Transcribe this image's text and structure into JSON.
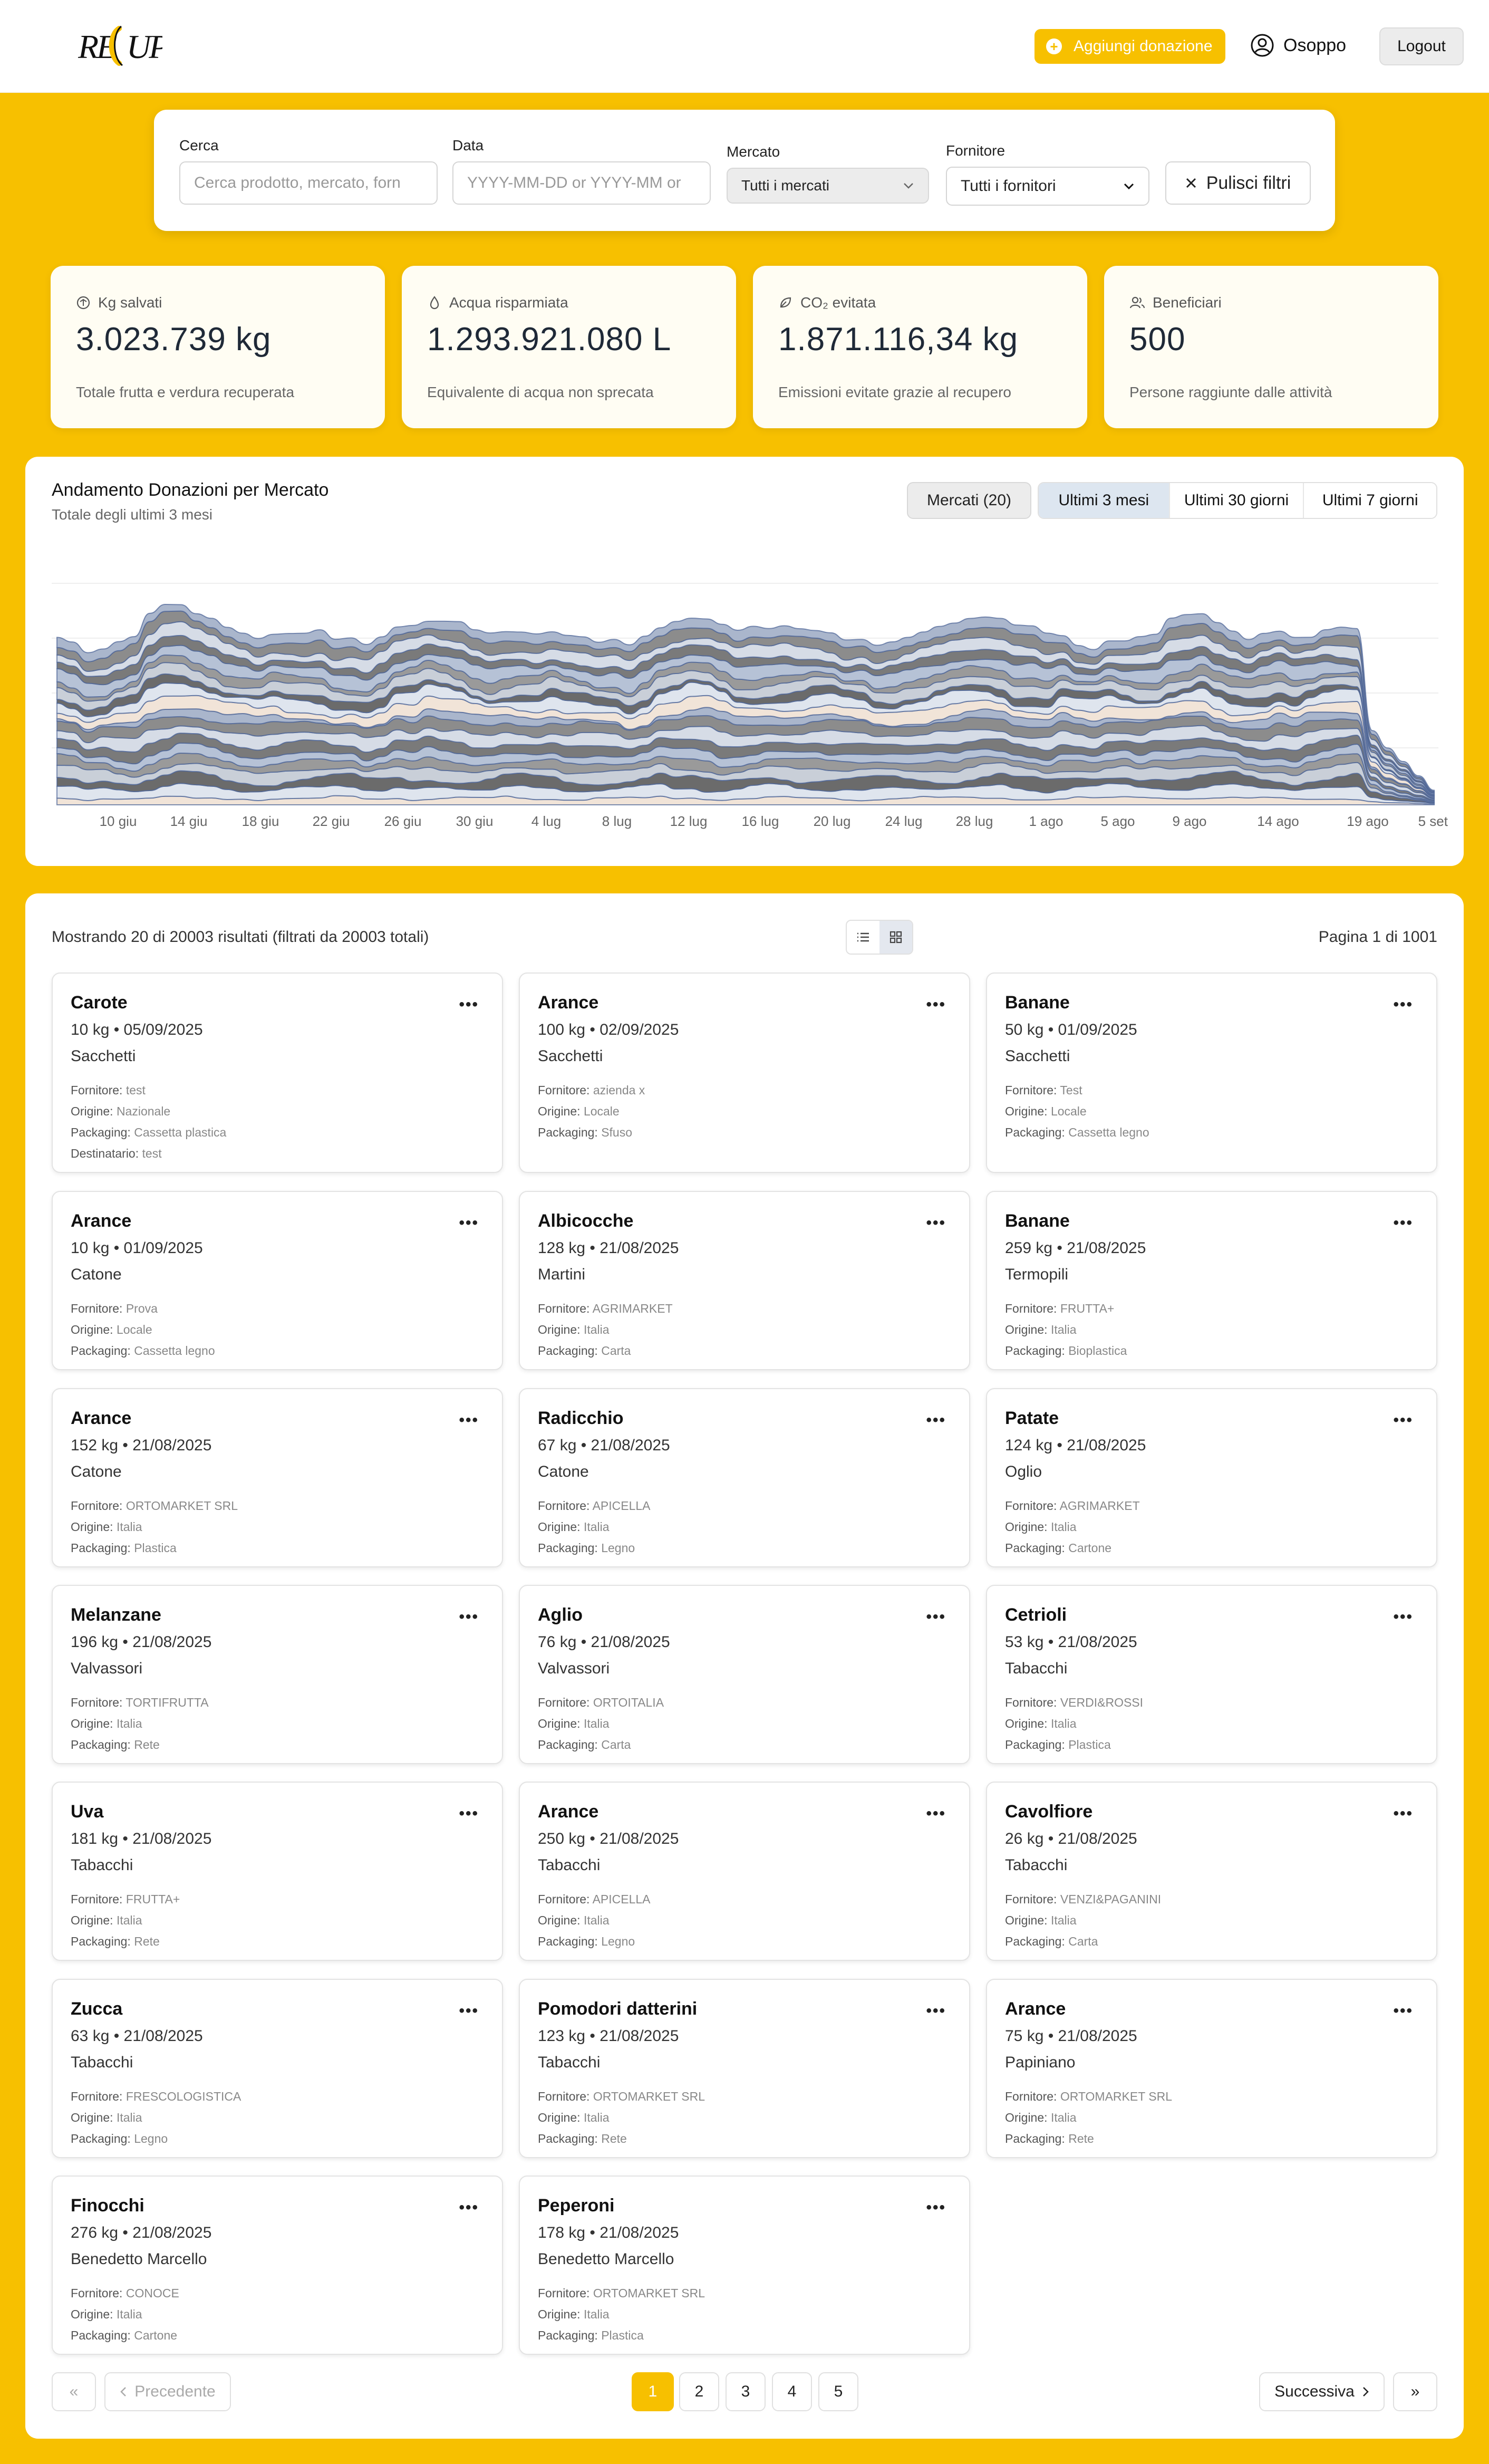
{
  "header": {
    "logo_text": "RECUP",
    "donate_label": "Aggiungi donazione",
    "user_name": "Osoppo",
    "logout_label": "Logout"
  },
  "filters": {
    "search_label": "Cerca",
    "search_placeholder": "Cerca prodotto, mercato, forn",
    "date_label": "Data",
    "date_placeholder": "YYYY-MM-DD or YYYY-MM or",
    "market_label": "Mercato",
    "market_value": "Tutti i mercati",
    "supplier_label": "Fornitore",
    "supplier_value": "Tutti i fornitori",
    "clear_label": "Pulisci filtri"
  },
  "stats": [
    {
      "label": "Kg salvati",
      "value": "3.023.739 kg",
      "desc": "Totale frutta e verdura recuperata",
      "icon": "scale-icon"
    },
    {
      "label": "Acqua risparmiata",
      "value": "1.293.921.080 L",
      "desc": "Equivalente di acqua non sprecata",
      "icon": "droplet-icon"
    },
    {
      "label": "CO₂ evitata",
      "value": "1.871.116,34 kg",
      "desc": "Emissioni evitate grazie al recupero",
      "icon": "leaf-icon"
    },
    {
      "label": "Beneficiari",
      "value": "500",
      "desc": "Persone raggiunte dalle attività",
      "icon": "users-icon"
    }
  ],
  "chart": {
    "title": "Andamento Donazioni per Mercato",
    "subtitle": "Totale degli ultimi 3 mesi",
    "markets_button": "Mercati (20)",
    "ranges": [
      "Ultimi 3 mesi",
      "Ultimi 30 giorni",
      "Ultimi 7 giorni"
    ],
    "active_range": "Ultimi 3 mesi"
  },
  "chart_data": {
    "type": "area",
    "x_tick_labels": [
      "10 giu",
      "14 giu",
      "18 giu",
      "22 giu",
      "26 giu",
      "30 giu",
      "4 lug",
      "8 lug",
      "12 lug",
      "16 lug",
      "20 lug",
      "24 lug",
      "28 lug",
      "1 ago",
      "5 ago",
      "9 ago",
      "14 ago",
      "19 ago",
      "5 set"
    ],
    "stacked": true,
    "series_count": 20,
    "grid": "horizontal",
    "colors": [
      "#f1e4d8",
      "#dfe5ee",
      "#6b6b6b",
      "#c9cfd8",
      "#9a9a9a",
      "#b6c2d6",
      "#7a7a7a",
      "#d6dce6",
      "#8c8c8c",
      "#aab6cc"
    ]
  },
  "results": {
    "summary": "Mostrando 20 di 20003 risultati (filtrati da 20003 totali)",
    "page_info": "Pagina 1 di 1001",
    "labels": {
      "fornitore": "Fornitore:",
      "origine": "Origine:",
      "packaging": "Packaging:",
      "destinatario": "Destinatario:"
    },
    "items": [
      {
        "name": "Carote",
        "kgdate": "10 kg • 05/09/2025",
        "market": "Sacchetti",
        "fornitore": "test",
        "origine": "Nazionale",
        "packaging": "Cassetta plastica",
        "destinatario": "test"
      },
      {
        "name": "Arance",
        "kgdate": "100 kg • 02/09/2025",
        "market": "Sacchetti",
        "fornitore": "azienda x",
        "origine": "Locale",
        "packaging": "Sfuso"
      },
      {
        "name": "Banane",
        "kgdate": "50 kg • 01/09/2025",
        "market": "Sacchetti",
        "fornitore": "Test",
        "origine": "Locale",
        "packaging": "Cassetta legno"
      },
      {
        "name": "Arance",
        "kgdate": "10 kg • 01/09/2025",
        "market": "Catone",
        "fornitore": "Prova",
        "origine": "Locale",
        "packaging": "Cassetta legno"
      },
      {
        "name": "Albicocche",
        "kgdate": "128 kg • 21/08/2025",
        "market": "Martini",
        "fornitore": "AGRIMARKET",
        "origine": "Italia",
        "packaging": "Carta"
      },
      {
        "name": "Banane",
        "kgdate": "259 kg • 21/08/2025",
        "market": "Termopili",
        "fornitore": "FRUTTA+",
        "origine": "Italia",
        "packaging": "Bioplastica"
      },
      {
        "name": "Arance",
        "kgdate": "152 kg • 21/08/2025",
        "market": "Catone",
        "fornitore": "ORTOMARKET SRL",
        "origine": "Italia",
        "packaging": "Plastica"
      },
      {
        "name": "Radicchio",
        "kgdate": "67 kg • 21/08/2025",
        "market": "Catone",
        "fornitore": "APICELLA",
        "origine": "Italia",
        "packaging": "Legno"
      },
      {
        "name": "Patate",
        "kgdate": "124 kg • 21/08/2025",
        "market": "Oglio",
        "fornitore": "AGRIMARKET",
        "origine": "Italia",
        "packaging": "Cartone"
      },
      {
        "name": "Melanzane",
        "kgdate": "196 kg • 21/08/2025",
        "market": "Valvassori",
        "fornitore": "TORTIFRUTTA",
        "origine": "Italia",
        "packaging": "Rete"
      },
      {
        "name": "Aglio",
        "kgdate": "76 kg • 21/08/2025",
        "market": "Valvassori",
        "fornitore": "ORTOITALIA",
        "origine": "Italia",
        "packaging": "Carta"
      },
      {
        "name": "Cetrioli",
        "kgdate": "53 kg • 21/08/2025",
        "market": "Tabacchi",
        "fornitore": "VERDI&ROSSI",
        "origine": "Italia",
        "packaging": "Plastica"
      },
      {
        "name": "Uva",
        "kgdate": "181 kg • 21/08/2025",
        "market": "Tabacchi",
        "fornitore": "FRUTTA+",
        "origine": "Italia",
        "packaging": "Rete"
      },
      {
        "name": "Arance",
        "kgdate": "250 kg • 21/08/2025",
        "market": "Tabacchi",
        "fornitore": "APICELLA",
        "origine": "Italia",
        "packaging": "Legno"
      },
      {
        "name": "Cavolfiore",
        "kgdate": "26 kg • 21/08/2025",
        "market": "Tabacchi",
        "fornitore": "VENZI&PAGANINI",
        "origine": "Italia",
        "packaging": "Carta"
      },
      {
        "name": "Zucca",
        "kgdate": "63 kg • 21/08/2025",
        "market": "Tabacchi",
        "fornitore": "FRESCOLOGISTICA",
        "origine": "Italia",
        "packaging": "Legno"
      },
      {
        "name": "Pomodori datterini",
        "kgdate": "123 kg • 21/08/2025",
        "market": "Tabacchi",
        "fornitore": "ORTOMARKET SRL",
        "origine": "Italia",
        "packaging": "Rete"
      },
      {
        "name": "Arance",
        "kgdate": "75 kg • 21/08/2025",
        "market": "Papiniano",
        "fornitore": "ORTOMARKET SRL",
        "origine": "Italia",
        "packaging": "Rete"
      },
      {
        "name": "Finocchi",
        "kgdate": "276 kg • 21/08/2025",
        "market": "Benedetto Marcello",
        "fornitore": "CONOCE",
        "origine": "Italia",
        "packaging": "Cartone"
      },
      {
        "name": "Peperoni",
        "kgdate": "178 kg • 21/08/2025",
        "market": "Benedetto Marcello",
        "fornitore": "ORTOMARKET SRL",
        "origine": "Italia",
        "packaging": "Plastica"
      }
    ]
  },
  "pagination": {
    "first_label": "«",
    "prev_label": "Precedente",
    "pages": [
      "1",
      "2",
      "3",
      "4",
      "5"
    ],
    "current": "1",
    "next_label": "Successiva",
    "last_label": "»"
  },
  "colors": {
    "accent": "#f7c000"
  }
}
